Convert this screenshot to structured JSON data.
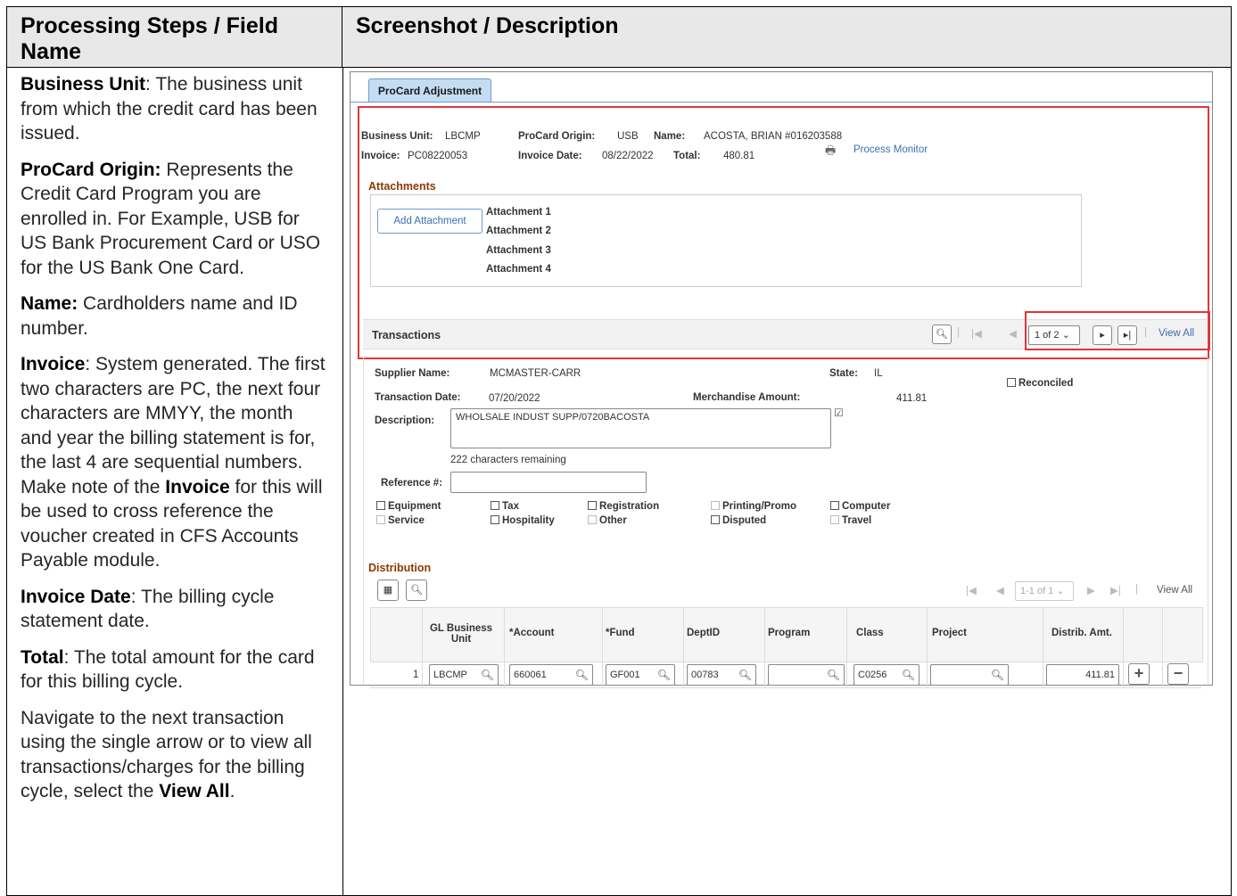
{
  "header": {
    "left": "Processing Steps / Field Name",
    "right": "Screenshot / Description"
  },
  "left_col": {
    "p1_term": "Business Unit",
    "p1_text": ":  The business unit from which the credit card has been issued.",
    "p2_term": "ProCard Origin:",
    "p2_text": " Represents the Credit Card Program you are enrolled in. For Example, USB for US Bank Procurement Card or USO for the US Bank One Card.",
    "p3_term": "Name:",
    "p3_text": " Cardholders name and ID number.",
    "p4_term": "Invoice",
    "p4_text_a": ": System generated. The first two characters are PC, the next four characters are MMYY, the month and year the billing statement is for, the last 4 are sequential numbers.  Make note of the ",
    "p4_term2": "Invoice",
    "p4_text_b": " for this will be used to cross reference the voucher created in CFS Accounts Payable module.",
    "p5_term": "Invoice Date",
    "p5_text": ":  The billing cycle statement date.",
    "p6_term": "Total",
    "p6_text": ":  The total amount for the card for this billing cycle.",
    "p7_text": "Navigate to the next transaction using the single arrow or to view all transactions/charges for the billing cycle, select the ",
    "p7_term": "View All",
    "p7_end": "."
  },
  "screen": {
    "tab": "ProCard Adjustment",
    "bu_label": "Business Unit:",
    "bu_value": "LBCMP",
    "origin_label": "ProCard Origin:",
    "origin_value": "USB",
    "name_label": "Name:",
    "name_value": "ACOSTA, BRIAN  #016203588",
    "invoice_label": "Invoice:",
    "invoice_value": "PC08220053",
    "invdate_label": "Invoice Date:",
    "invdate_value": "08/22/2022",
    "total_label": "Total:",
    "total_value": "480.81",
    "process_monitor": "Process Monitor",
    "attachments_title": "Attachments",
    "add_attachment": "Add Attachment",
    "attachments": [
      "Attachment 1",
      "Attachment 2",
      "Attachment 3",
      "Attachment 4"
    ],
    "transactions_title": "Transactions",
    "trans_pager": "1 of 2",
    "view_all": "View All",
    "supplier_label": "Supplier Name:",
    "supplier_value": "MCMASTER-CARR",
    "state_label": "State:",
    "state_value": "IL",
    "reconciled": "Reconciled",
    "transdate_label": "Transaction Date:",
    "transdate_value": "07/20/2022",
    "merch_label": "Merchandise Amount:",
    "merch_value": "411.81",
    "desc_label": "Description:",
    "desc_value": "WHOLSALE INDUST SUPP/0720BACOSTA",
    "chars_remaining": "222 characters remaining",
    "ref_label": "Reference #:",
    "checks": {
      "equipment": "Equipment",
      "tax": "Tax",
      "registration": "Registration",
      "printing": "Printing/Promo",
      "computer": "Computer",
      "service": "Service",
      "hospitality": "Hospitality",
      "other": "Other",
      "disputed": "Disputed",
      "travel": "Travel"
    },
    "distribution_title": "Distribution",
    "dist_pager": "1-1 of 1",
    "dist_view_all": "View All",
    "cols": {
      "glbu": "GL Business Unit",
      "account": "*Account",
      "fund": "*Fund",
      "dept": "DeptID",
      "program": "Program",
      "class": "Class",
      "project": "Project",
      "amt": "Distrib. Amt."
    },
    "row": {
      "num": "1",
      "glbu": "LBCMP",
      "account": "660061",
      "fund": "GF001",
      "dept": "00783",
      "program": "",
      "class": "C0256",
      "project": "",
      "amt": "411.81"
    }
  }
}
